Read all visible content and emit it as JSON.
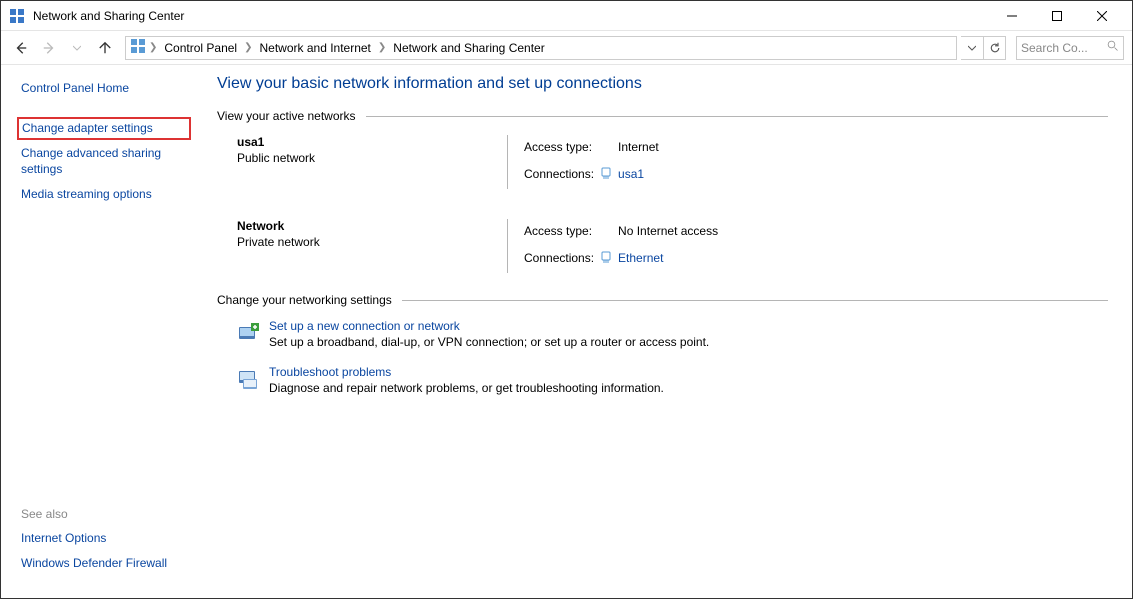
{
  "window": {
    "title": "Network and Sharing Center"
  },
  "breadcrumb": {
    "items": [
      "Control Panel",
      "Network and Internet",
      "Network and Sharing Center"
    ]
  },
  "search": {
    "placeholder": "Search Co..."
  },
  "sidebar": {
    "home": "Control Panel Home",
    "links": [
      "Change adapter settings",
      "Change advanced sharing settings",
      "Media streaming options"
    ],
    "see_also_label": "See also",
    "see_also": [
      "Internet Options",
      "Windows Defender Firewall"
    ]
  },
  "main": {
    "title": "View your basic network information and set up connections",
    "section1_label": "View your active networks",
    "networks": [
      {
        "name": "usa1",
        "type": "Public network",
        "access_type_label": "Access type:",
        "access_type": "Internet",
        "connections_label": "Connections:",
        "connection": "usa1"
      },
      {
        "name": "Network",
        "type": "Private network",
        "access_type_label": "Access type:",
        "access_type": "No Internet access",
        "connections_label": "Connections:",
        "connection": "Ethernet"
      }
    ],
    "section2_label": "Change your networking settings",
    "actions": [
      {
        "title": "Set up a new connection or network",
        "desc": "Set up a broadband, dial-up, or VPN connection; or set up a router or access point."
      },
      {
        "title": "Troubleshoot problems",
        "desc": "Diagnose and repair network problems, or get troubleshooting information."
      }
    ]
  }
}
